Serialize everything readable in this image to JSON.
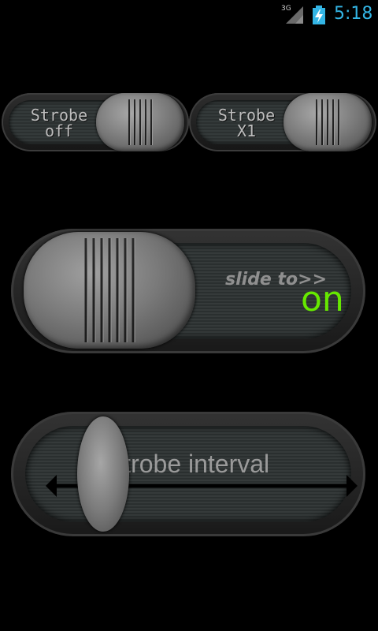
{
  "status_bar": {
    "network": "3G",
    "time": "5:18",
    "accent": "#33b5e5"
  },
  "strobe_toggles": [
    {
      "line1": "Strobe",
      "line2": "off"
    },
    {
      "line1": "Strobe",
      "line2": "X1"
    }
  ],
  "main_slider": {
    "hint": "slide to>>",
    "value": "on",
    "value_color": "#66e800"
  },
  "interval_slider": {
    "label": "Strobe interval"
  },
  "icons": [
    "signal-icon",
    "battery-charging-icon",
    "double-arrow-icon"
  ]
}
